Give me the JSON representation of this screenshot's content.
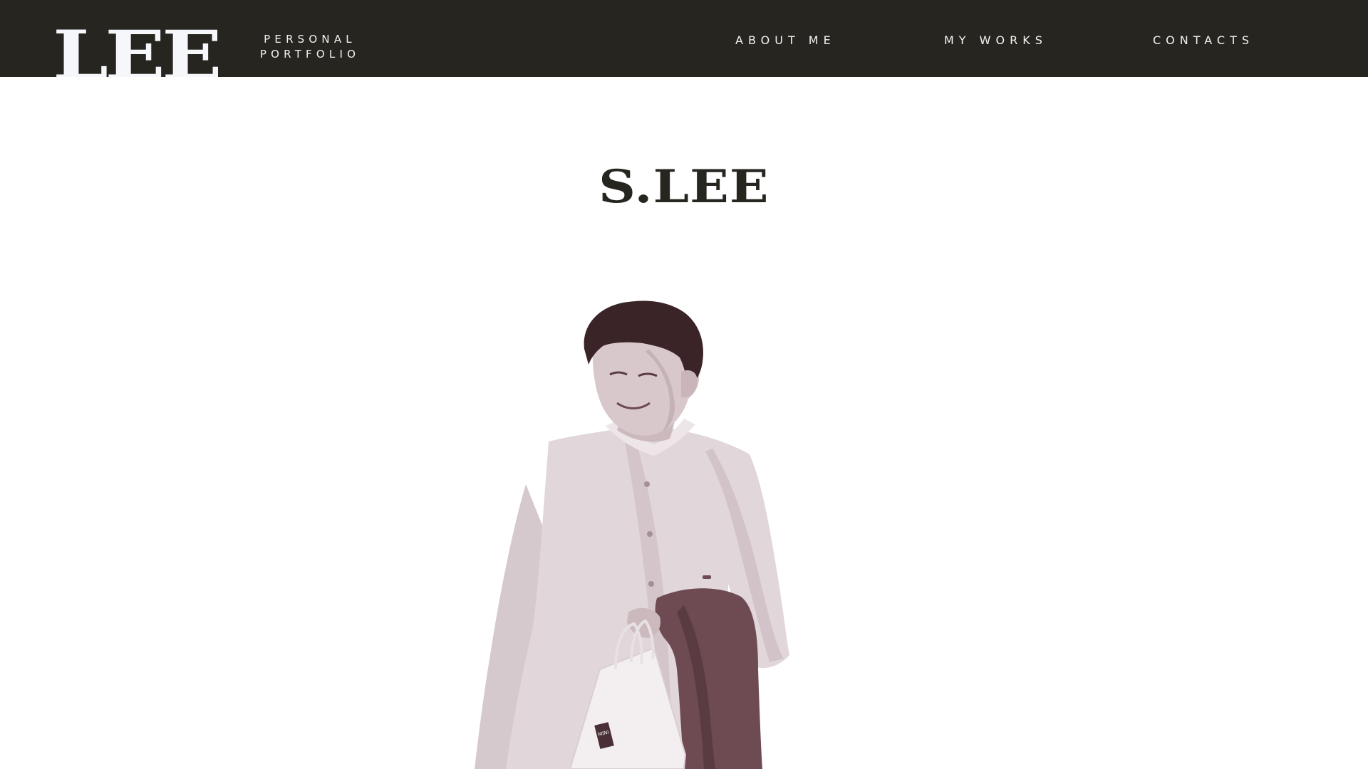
{
  "header": {
    "logo_text": "LEE",
    "tagline_line1": "PERSONAL",
    "tagline_line2": "PORTFOLIO",
    "nav": {
      "about": "ABOUT ME",
      "works": "MY WORKS",
      "contacts": "CONTACTS"
    }
  },
  "hero": {
    "title": "S.LEE",
    "portrait_bag_text": "MINI SO"
  },
  "colors": {
    "header_bg": "#26251f",
    "header_text": "#f3f3f3",
    "page_bg": "#ffffff",
    "title": "#26251f",
    "photo_duotone": "#6e4a52"
  }
}
